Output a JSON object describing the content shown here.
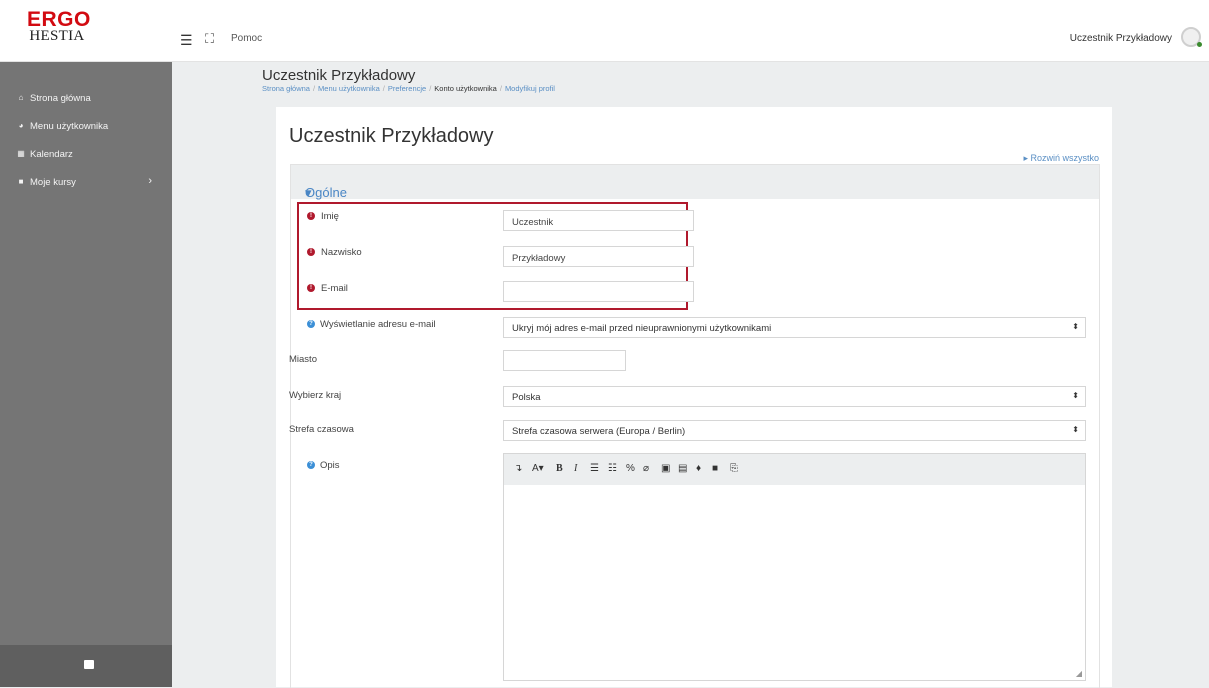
{
  "brand": {
    "line1": "ERGO",
    "line2": "HESTIA"
  },
  "topbar": {
    "menu_icon": "hamburger-icon",
    "fullscreen_icon": "fullscreen-icon",
    "help": "Pomoc",
    "user_name": "Uczestnik Przykładowy"
  },
  "sidebar": {
    "items": [
      {
        "label": "Strona główna",
        "icon": "home-icon"
      },
      {
        "label": "Menu użytkownika",
        "icon": "dashboard-icon"
      },
      {
        "label": "Kalendarz",
        "icon": "calendar-icon"
      },
      {
        "label": "Moje kursy",
        "icon": "courses-icon"
      }
    ],
    "footer_icon": "block-icon"
  },
  "header": {
    "title": "Uczestnik Przykładowy",
    "breadcrumb": [
      "Strona główna",
      "Menu użytkownika",
      "Preferencje",
      "Konto użytkownika",
      "Modyfikuj profil"
    ]
  },
  "form": {
    "title": "Uczestnik Przykładowy",
    "expand_all": "Rozwiń wszystko",
    "section": "Ogólne",
    "fields": {
      "firstname": {
        "label": "Imię",
        "value": "Uczestnik"
      },
      "lastname": {
        "label": "Nazwisko",
        "value": "Przykładowy"
      },
      "email": {
        "label": "E-mail",
        "value": ""
      },
      "maildisplay": {
        "label": "Wyświetlanie adresu e-mail",
        "value": "Ukryj mój adres e-mail przed nieuprawnionymi użytkownikami"
      },
      "city": {
        "label": "Miasto",
        "value": ""
      },
      "country": {
        "label": "Wybierz kraj",
        "value": "Polska"
      },
      "timezone": {
        "label": "Strefa czasowa",
        "value": "Strefa czasowa serwera (Europa / Berlin)"
      },
      "description": {
        "label": "Opis",
        "value": ""
      }
    }
  },
  "colors": {
    "required": "#b0192d",
    "link": "#4a86c5",
    "sidebar": "#757575",
    "brand_red": "#d20a11"
  }
}
